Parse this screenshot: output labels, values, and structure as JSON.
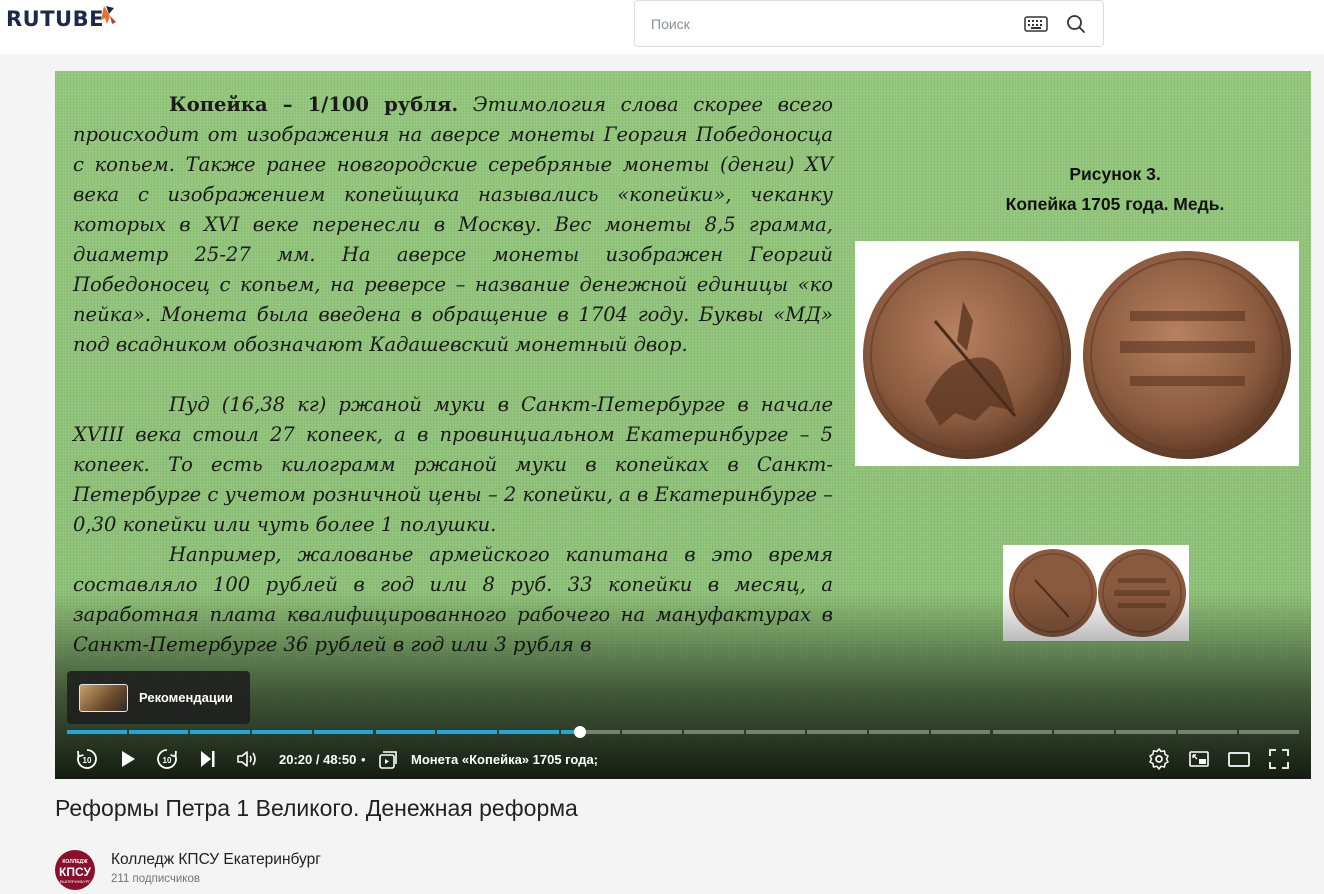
{
  "header": {
    "logo_text": "RUTUBE",
    "search": {
      "placeholder": "Поиск"
    }
  },
  "slide": {
    "paragraph1_bold": "Копейка – 1/100 рубля.",
    "paragraph1": " Этимология слова скорее всего происходит от изображения на аверсе монеты Георгия Победоносца с копьем. Также ранее новгородские серебряные монеты (денги) XV века с изображением копейщика назывались «копейки», чеканку которых в XVI веке перенесли в Москву. Вес монеты 8,5 грамма, диаметр 25-27 мм. На аверсе монеты изображен Георгий Победоносец с копьем, на реверсе – название денежной единицы «ко пейка». Монета была введена в обращение в 1704 году. Буквы «МД» под всадником обозначают Кадашевский монетный двор.",
    "paragraph2": "Пуд (16,38 кг) ржаной муки в Санкт-Петербурге в начале XVIII века стоил 27 копеек, а в провинциальном Екатеринбурге – 5 копеек. То есть килограмм ржаной муки в копейках в Санкт-Петербурге с учетом розничной цены – 2 копейки, а в Екатеринбурге – 0,30 копейки или чуть более 1 полушки.",
    "paragraph3": "Например, жалованье армейского капитана в это время составляло 100 рублей в год или 8 руб. 33 копейки в месяц, а заработная плата квалифицированного рабочего на мануфактурах в Санкт-Петербурге 36 рублей в год или 3 рубля в",
    "caption_line1": "Рисунок 3.",
    "caption_line2": "Копейка 1705 года. Медь."
  },
  "player": {
    "recommendations_label": "Рекомендации",
    "time_display": "20:20 / 48:50",
    "separator": "•",
    "chapter_title": "Монета «Копейка» 1705 года;",
    "progress_fraction": 0.416,
    "accent_color": "#21a6d9"
  },
  "video": {
    "title": "Реформы Петра 1 Великого. Денежная реформа"
  },
  "channel": {
    "name": "Колледж КПСУ Екатеринбург",
    "subscribers": "211 подписчиков"
  }
}
